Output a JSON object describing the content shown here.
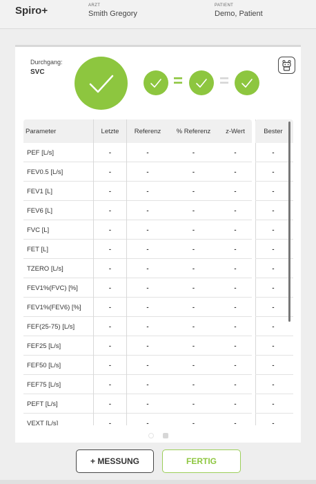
{
  "header": {
    "app_title": "Spiro+",
    "doctor_caption": "ARZT",
    "doctor_name": "Smith Gregory",
    "patient_caption": "PATIENT",
    "patient_name": "Demo, Patient"
  },
  "card": {
    "pass_caption": "Durchgang:",
    "pass_value": "SVC",
    "equals_symbol": "=",
    "robot_icon": "robot-icon",
    "check_icon": "checkmark-icon",
    "accent_color": "#8dc63f"
  },
  "table": {
    "columns": [
      "Parameter",
      "Letzte",
      "Referenz",
      "% Referenz",
      "z-Wert"
    ],
    "best_column": "Bester",
    "rows": [
      {
        "param": "PEF [L/s]",
        "letzte": "-",
        "referenz": "-",
        "pct_referenz": "-",
        "z_wert": "-",
        "bester": "-"
      },
      {
        "param": "FEV0.5 [L/s]",
        "letzte": "-",
        "referenz": "-",
        "pct_referenz": "-",
        "z_wert": "-",
        "bester": "-"
      },
      {
        "param": "FEV1 [L]",
        "letzte": "-",
        "referenz": "-",
        "pct_referenz": "-",
        "z_wert": "-",
        "bester": "-"
      },
      {
        "param": "FEV6 [L]",
        "letzte": "-",
        "referenz": "-",
        "pct_referenz": "-",
        "z_wert": "-",
        "bester": "-"
      },
      {
        "param": "FVC [L]",
        "letzte": "-",
        "referenz": "-",
        "pct_referenz": "-",
        "z_wert": "-",
        "bester": "-"
      },
      {
        "param": "FET [L]",
        "letzte": "-",
        "referenz": "-",
        "pct_referenz": "-",
        "z_wert": "-",
        "bester": "-"
      },
      {
        "param": "TZERO [L/s]",
        "letzte": "-",
        "referenz": "-",
        "pct_referenz": "-",
        "z_wert": "-",
        "bester": "-"
      },
      {
        "param": "FEV1%(FVC) [%]",
        "letzte": "-",
        "referenz": "-",
        "pct_referenz": "-",
        "z_wert": "-",
        "bester": "-"
      },
      {
        "param": "FEV1%(FEV6) [%]",
        "letzte": "-",
        "referenz": "-",
        "pct_referenz": "-",
        "z_wert": "-",
        "bester": "-"
      },
      {
        "param": "FEF(25-75) [L/s]",
        "letzte": "-",
        "referenz": "-",
        "pct_referenz": "-",
        "z_wert": "-",
        "bester": "-"
      },
      {
        "param": "FEF25 [L/s]",
        "letzte": "-",
        "referenz": "-",
        "pct_referenz": "-",
        "z_wert": "-",
        "bester": "-"
      },
      {
        "param": "FEF50 [L/s]",
        "letzte": "-",
        "referenz": "-",
        "pct_referenz": "-",
        "z_wert": "-",
        "bester": "-"
      },
      {
        "param": "FEF75 [L/s]",
        "letzte": "-",
        "referenz": "-",
        "pct_referenz": "-",
        "z_wert": "-",
        "bester": "-"
      },
      {
        "param": "PEFT [L/s]",
        "letzte": "-",
        "referenz": "-",
        "pct_referenz": "-",
        "z_wert": "-",
        "bester": "-"
      },
      {
        "param": "VEXT [L/s]",
        "letzte": "-",
        "referenz": "-",
        "pct_referenz": "-",
        "z_wert": "-",
        "bester": "-"
      }
    ]
  },
  "pager": {
    "pages": 2,
    "current": 2
  },
  "buttons": {
    "add_measurement": "+ MESSUNG",
    "done": "FERTIG"
  }
}
